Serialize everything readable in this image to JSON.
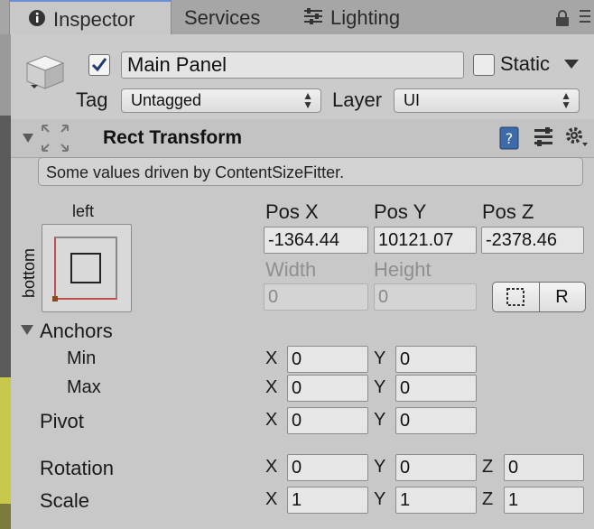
{
  "tabs": [
    {
      "label": "Inspector",
      "active": true,
      "icon": "info-icon"
    },
    {
      "label": "Services",
      "active": false
    },
    {
      "label": "Lighting",
      "active": false,
      "icon": "sliders-icon"
    }
  ],
  "header": {
    "active_checked": true,
    "object_name": "Main Panel",
    "static_label": "Static",
    "static_checked": false,
    "tag_label": "Tag",
    "tag_value": "Untagged",
    "layer_label": "Layer",
    "layer_value": "UI"
  },
  "component": {
    "title": "Rect Transform",
    "help_text": "Some values driven by ContentSizeFitter.",
    "anchor_preset_top": "left",
    "anchor_preset_side": "bottom",
    "labels": {
      "pos_x": "Pos X",
      "pos_y": "Pos Y",
      "pos_z": "Pos Z",
      "width": "Width",
      "height": "Height",
      "anchors": "Anchors",
      "min": "Min",
      "max": "Max",
      "pivot": "Pivot",
      "rotation": "Rotation",
      "scale": "Scale",
      "x": "X",
      "y": "Y",
      "z": "Z",
      "raw_edit_btn": "R"
    },
    "values": {
      "pos_x": "-1364.44",
      "pos_y": "10121.07",
      "pos_z": "-2378.46",
      "width": "0",
      "height": "0",
      "anchor_min_x": "0",
      "anchor_min_y": "0",
      "anchor_max_x": "0",
      "anchor_max_y": "0",
      "pivot_x": "0",
      "pivot_y": "0",
      "rotation_x": "0",
      "rotation_y": "0",
      "rotation_z": "0",
      "scale_x": "1",
      "scale_y": "1",
      "scale_z": "1"
    }
  },
  "colors": {
    "accent": "#6c8fd6",
    "panel": "#c8c8c8",
    "anchor_red": "#c0504d"
  }
}
